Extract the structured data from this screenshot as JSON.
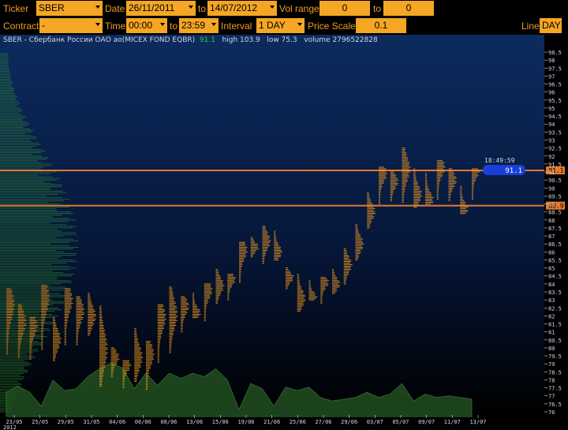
{
  "toolbar1": {
    "ticker_label": "Ticker",
    "ticker_value": "SBER",
    "date_label": "Date",
    "date_from": "26/11/2011",
    "to_label": "to",
    "date_to": "14/07/2012",
    "vol_range_label": "Vol range",
    "vol_from": "0",
    "vol_to_label": "to",
    "vol_to": "0"
  },
  "toolbar2": {
    "contract_label": "Contract",
    "contract_value": "-",
    "time_label": "Time",
    "time_from": "00:00",
    "to_label": "to",
    "time_to": "23:59",
    "interval_label": "Interval",
    "interval_value": "1 DAY",
    "price_scale_label": "Price Scale",
    "price_scale_value": "0.1",
    "line_label": "Line",
    "line_value": "DAY"
  },
  "header": {
    "instrument": "SBER - Сбербанк России ОАО ао(MICEX FOND EQBR)",
    "last": "91.1",
    "high_text": "high 103.9",
    "low_text": "low 75.3",
    "volume_text": "volume 2796522828"
  },
  "colors": {
    "accent": "#f5a623",
    "bg_top": "#0b2a5c",
    "bg_bottom": "#000000",
    "profile": "#f39c1e",
    "volume_profile": "#2f8a2f",
    "volume_area": "#1f4a1f",
    "level_line": "#e8782a",
    "price_tag": "#1a3fd8"
  },
  "chart_data": {
    "type": "volume-profile",
    "x_tick_labels": [
      "23/05",
      "25/05",
      "29/05",
      "31/05",
      "04/06",
      "06/06",
      "08/06",
      "13/06",
      "15/06",
      "19/06",
      "21/06",
      "25/06",
      "27/06",
      "29/06",
      "03/07",
      "05/07",
      "09/07",
      "11/07",
      "13/07"
    ],
    "x_year_label": "2012",
    "y_tick_labels": [
      "98.5",
      "98",
      "97.5",
      "97",
      "96.5",
      "96",
      "95.5",
      "95",
      "94.5",
      "94",
      "93.5",
      "93",
      "92.5",
      "92",
      "91.5",
      "91",
      "90.5",
      "90",
      "89.5",
      "89",
      "88.5",
      "88",
      "87.5",
      "87",
      "86.5",
      "86",
      "85.5",
      "85",
      "84.5",
      "84",
      "83.5",
      "83",
      "82.5",
      "82",
      "81.5",
      "81",
      "80.5",
      "80",
      "79.5",
      "79",
      "78.5",
      "78",
      "77.5",
      "77",
      "76.5",
      "76"
    ],
    "ylim": [
      75.9,
      98.7
    ],
    "price_levels": [
      {
        "price": 91.1,
        "label": "91.1"
      },
      {
        "price": 88.9,
        "label": "88.9"
      }
    ],
    "last_price_tag": "91.1",
    "last_time": "18:49:59",
    "daily_ranges": [
      [
        79.6,
        83.7,
        82.7
      ],
      [
        79.4,
        82.7,
        81.6
      ],
      [
        79.3,
        81.9,
        81.4
      ],
      [
        79.9,
        83.9,
        83.1
      ],
      [
        79.2,
        81.9,
        80.5
      ],
      [
        80.2,
        83.7,
        83.0
      ],
      [
        80.2,
        83.2,
        82.3
      ],
      [
        80.8,
        83.4,
        82.0
      ],
      [
        77.6,
        82.6,
        79.9
      ],
      [
        78.2,
        80.0,
        79.4
      ],
      [
        77.5,
        79.2,
        78.9
      ],
      [
        77.9,
        81.2,
        79.4
      ],
      [
        77.4,
        80.4,
        79.6
      ],
      [
        79.1,
        82.7,
        81.9
      ],
      [
        79.7,
        83.8,
        82.1
      ],
      [
        81.0,
        83.2,
        82.6
      ],
      [
        81.9,
        83.4,
        82.2
      ],
      [
        81.7,
        84.0,
        83.6
      ],
      [
        82.8,
        84.9,
        83.9
      ],
      [
        83.0,
        84.6,
        84.3
      ],
      [
        84.1,
        86.6,
        86.1
      ],
      [
        85.7,
        86.9,
        86.3
      ],
      [
        85.3,
        87.6,
        86.7
      ],
      [
        85.5,
        87.3,
        86.0
      ],
      [
        83.7,
        85.0,
        84.4
      ],
      [
        82.3,
        84.6,
        83.1
      ],
      [
        83.0,
        84.2,
        83.2
      ],
      [
        82.8,
        84.4,
        84.1
      ],
      [
        83.4,
        84.9,
        84.0
      ],
      [
        84.0,
        86.2,
        85.2
      ],
      [
        85.5,
        87.7,
        86.5
      ],
      [
        87.5,
        89.7,
        88.5
      ],
      [
        89.0,
        91.3,
        90.9
      ],
      [
        89.2,
        91.0,
        90.4
      ],
      [
        89.1,
        92.5,
        91.2
      ],
      [
        88.8,
        91.2,
        89.6
      ],
      [
        89.0,
        90.9,
        89.3
      ],
      [
        89.3,
        91.7,
        91.3
      ],
      [
        89.2,
        91.2,
        90.5
      ],
      [
        88.4,
        90.1,
        88.7
      ],
      [
        89.3,
        91.2,
        91.1
      ]
    ],
    "daily_volume": [
      0.28,
      0.35,
      0.28,
      0.12,
      0.42,
      0.3,
      0.32,
      0.46,
      0.55,
      0.62,
      0.56,
      0.32,
      0.5,
      0.36,
      0.5,
      0.44,
      0.5,
      0.46,
      0.55,
      0.42,
      0.08,
      0.38,
      0.32,
      0.12,
      0.34,
      0.3,
      0.34,
      0.22,
      0.18,
      0.2,
      0.22,
      0.28,
      0.22,
      0.26,
      0.38,
      0.18,
      0.26,
      0.22,
      0.24,
      0.22,
      0.2
    ]
  }
}
